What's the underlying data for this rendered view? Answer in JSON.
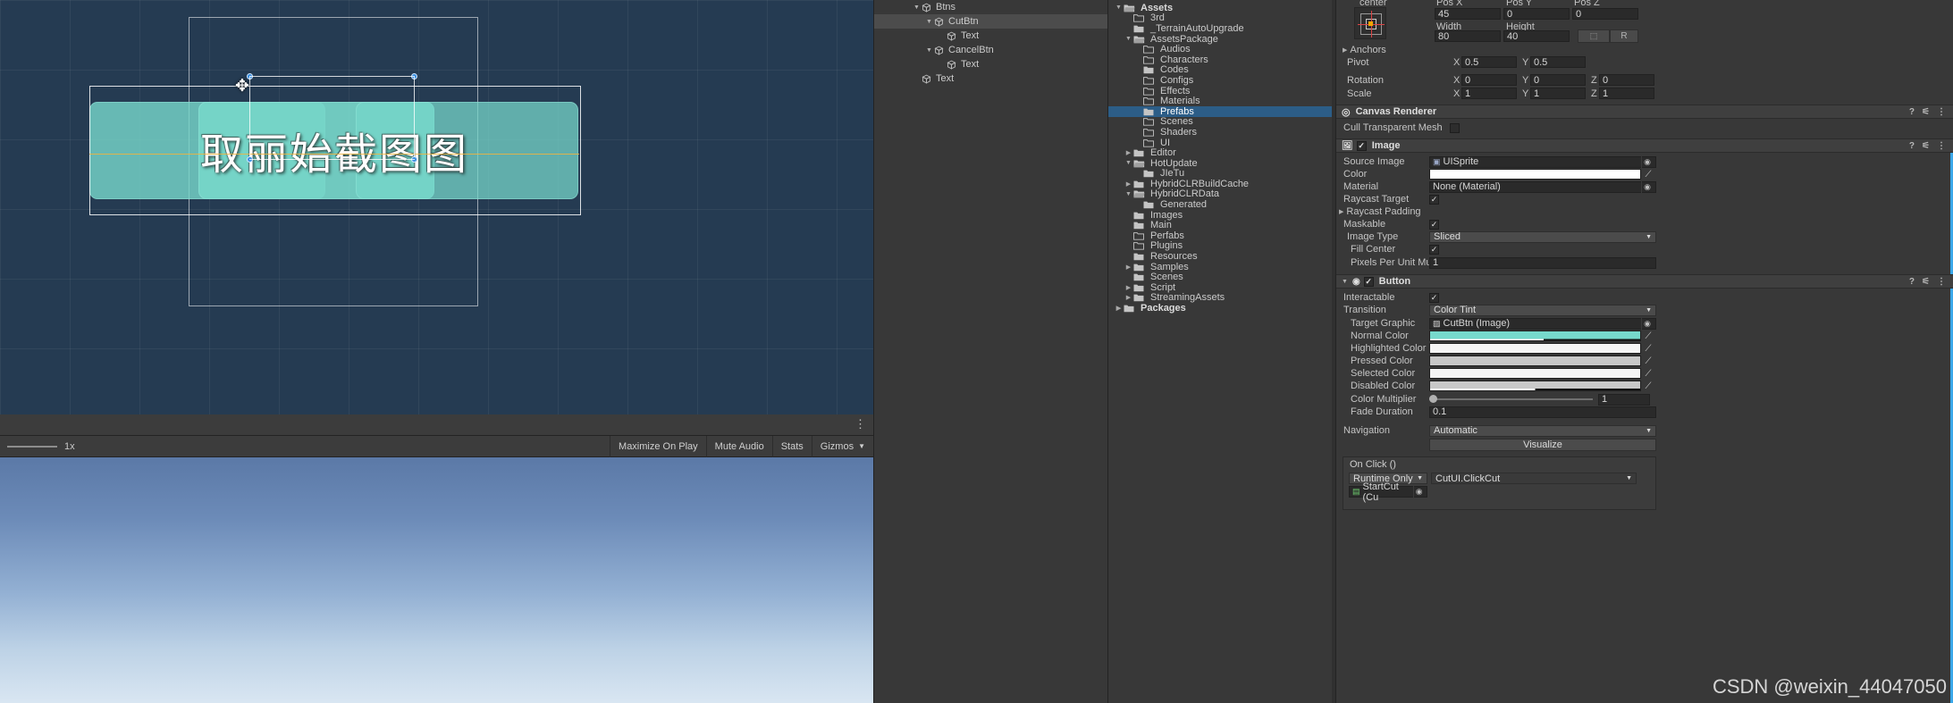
{
  "scene": {
    "overlapped_button_text": "取丽始截图图",
    "cursor_icon": "move-cursor-icon"
  },
  "gameview": {
    "zoom_label": "1x",
    "buttons": [
      {
        "label": "Maximize On Play",
        "name": "maximize-on-play"
      },
      {
        "label": "Mute Audio",
        "name": "mute-audio"
      },
      {
        "label": "Stats",
        "name": "stats"
      },
      {
        "label": "Gizmos",
        "name": "gizmos",
        "caret": "▼"
      }
    ],
    "kebab": "⋮"
  },
  "hierarchy": {
    "items": [
      {
        "label": "Btns",
        "indent": 3,
        "tri": "▼",
        "selected": false
      },
      {
        "label": "CutBtn",
        "indent": 4,
        "tri": "▼",
        "selected": true
      },
      {
        "label": "Text",
        "indent": 5,
        "tri": "",
        "selected": false
      },
      {
        "label": "CancelBtn",
        "indent": 4,
        "tri": "▼",
        "selected": false
      },
      {
        "label": "Text",
        "indent": 5,
        "tri": "",
        "selected": false
      },
      {
        "label": "Text",
        "indent": 3,
        "tri": "",
        "selected": false
      }
    ]
  },
  "project": {
    "items": [
      {
        "label": "Assets",
        "indent": 0,
        "tri": "▼",
        "icon": "folder-open",
        "bold": true,
        "selected": false
      },
      {
        "label": "3rd",
        "indent": 1,
        "tri": "",
        "icon": "folder-empty",
        "bold": false,
        "selected": false
      },
      {
        "label": "_TerrainAutoUpgrade",
        "indent": 1,
        "tri": "",
        "icon": "folder-full",
        "bold": false,
        "selected": false
      },
      {
        "label": "AssetsPackage",
        "indent": 1,
        "tri": "▼",
        "icon": "folder-open",
        "bold": false,
        "selected": false
      },
      {
        "label": "Audios",
        "indent": 2,
        "tri": "",
        "icon": "folder-empty",
        "bold": false,
        "selected": false
      },
      {
        "label": "Characters",
        "indent": 2,
        "tri": "",
        "icon": "folder-empty",
        "bold": false,
        "selected": false
      },
      {
        "label": "Codes",
        "indent": 2,
        "tri": "",
        "icon": "folder-full",
        "bold": false,
        "selected": false
      },
      {
        "label": "Configs",
        "indent": 2,
        "tri": "",
        "icon": "folder-empty",
        "bold": false,
        "selected": false
      },
      {
        "label": "Effects",
        "indent": 2,
        "tri": "",
        "icon": "folder-empty",
        "bold": false,
        "selected": false
      },
      {
        "label": "Materials",
        "indent": 2,
        "tri": "",
        "icon": "folder-empty",
        "bold": false,
        "selected": false
      },
      {
        "label": "Prefabs",
        "indent": 2,
        "tri": "",
        "icon": "folder-full",
        "bold": false,
        "selected": true
      },
      {
        "label": "Scenes",
        "indent": 2,
        "tri": "",
        "icon": "folder-empty",
        "bold": false,
        "selected": false
      },
      {
        "label": "Shaders",
        "indent": 2,
        "tri": "",
        "icon": "folder-empty",
        "bold": false,
        "selected": false
      },
      {
        "label": "UI",
        "indent": 2,
        "tri": "",
        "icon": "folder-empty",
        "bold": false,
        "selected": false
      },
      {
        "label": "Editor",
        "indent": 1,
        "tri": "▶",
        "icon": "folder-full",
        "bold": false,
        "selected": false
      },
      {
        "label": "HotUpdate",
        "indent": 1,
        "tri": "▼",
        "icon": "folder-open",
        "bold": false,
        "selected": false
      },
      {
        "label": "JIeTu",
        "indent": 2,
        "tri": "",
        "icon": "folder-full",
        "bold": false,
        "selected": false
      },
      {
        "label": "HybridCLRBuildCache",
        "indent": 1,
        "tri": "▶",
        "icon": "folder-full",
        "bold": false,
        "selected": false
      },
      {
        "label": "HybridCLRData",
        "indent": 1,
        "tri": "▼",
        "icon": "folder-open",
        "bold": false,
        "selected": false
      },
      {
        "label": "Generated",
        "indent": 2,
        "tri": "",
        "icon": "folder-full",
        "bold": false,
        "selected": false
      },
      {
        "label": "Images",
        "indent": 1,
        "tri": "",
        "icon": "folder-full",
        "bold": false,
        "selected": false
      },
      {
        "label": "Main",
        "indent": 1,
        "tri": "",
        "icon": "folder-full",
        "bold": false,
        "selected": false
      },
      {
        "label": "Perfabs",
        "indent": 1,
        "tri": "",
        "icon": "folder-empty",
        "bold": false,
        "selected": false
      },
      {
        "label": "Plugins",
        "indent": 1,
        "tri": "",
        "icon": "folder-empty",
        "bold": false,
        "selected": false
      },
      {
        "label": "Resources",
        "indent": 1,
        "tri": "",
        "icon": "folder-full",
        "bold": false,
        "selected": false
      },
      {
        "label": "Samples",
        "indent": 1,
        "tri": "▶",
        "icon": "folder-full",
        "bold": false,
        "selected": false
      },
      {
        "label": "Scenes",
        "indent": 1,
        "tri": "",
        "icon": "folder-full",
        "bold": false,
        "selected": false
      },
      {
        "label": "Script",
        "indent": 1,
        "tri": "▶",
        "icon": "folder-full",
        "bold": false,
        "selected": false
      },
      {
        "label": "StreamingAssets",
        "indent": 1,
        "tri": "▶",
        "icon": "folder-full",
        "bold": false,
        "selected": false
      },
      {
        "label": "Packages",
        "indent": 0,
        "tri": "▶",
        "icon": "folder-full",
        "bold": true,
        "selected": false
      }
    ]
  },
  "inspector": {
    "rect_transform": {
      "anchor_preset_label": "center",
      "pos_x_label": "Pos X",
      "pos_x": "45",
      "pos_y_label": "Pos Y",
      "pos_y": "0",
      "pos_z_label": "Pos Z",
      "pos_z": "0",
      "width_label": "Width",
      "width": "80",
      "height_label": "Height",
      "height": "40",
      "blueprint_btn": "⬚",
      "raw_btn": "R",
      "anchors_label": "Anchors",
      "pivot_label": "Pivot",
      "pivot_x": "0.5",
      "pivot_y": "0.5",
      "rotation_label": "Rotation",
      "rot_x": "0",
      "rot_y": "0",
      "rot_z": "0",
      "scale_label": "Scale",
      "scale_x": "1",
      "scale_y": "1",
      "scale_z": "1",
      "axis_x": "X",
      "axis_y": "Y",
      "axis_z": "Z"
    },
    "canvas_renderer": {
      "title": "Canvas Renderer",
      "cull_label": "Cull Transparent Mesh",
      "cull_checked": false
    },
    "image": {
      "title": "Image",
      "enabled": true,
      "source_image_label": "Source Image",
      "source_image_value": "UISprite",
      "color_label": "Color",
      "color_value": "#FFFFFF",
      "material_label": "Material",
      "material_value": "None (Material)",
      "raycast_target_label": "Raycast Target",
      "raycast_target_checked": true,
      "raycast_padding_label": "Raycast Padding",
      "maskable_label": "Maskable",
      "maskable_checked": true,
      "image_type_label": "Image Type",
      "image_type_value": "Sliced",
      "fill_center_label": "Fill Center",
      "fill_center_checked": true,
      "ppu_label": "Pixels Per Unit Multip",
      "ppu_value": "1"
    },
    "button": {
      "title": "Button",
      "enabled": true,
      "interactable_label": "Interactable",
      "interactable_checked": true,
      "transition_label": "Transition",
      "transition_value": "Color Tint",
      "target_graphic_label": "Target Graphic",
      "target_graphic_value": "CutBtn (Image)",
      "normal_color_label": "Normal Color",
      "normal_color_value": "#77D9CC",
      "highlighted_color_label": "Highlighted Color",
      "highlighted_color_value": "#F5F5F5",
      "pressed_color_label": "Pressed Color",
      "pressed_color_value": "#C8C8C8",
      "selected_color_label": "Selected Color",
      "selected_color_value": "#F5F5F5",
      "disabled_color_label": "Disabled Color",
      "disabled_color_value": "#C8C8C8",
      "color_multiplier_label": "Color Multiplier",
      "color_multiplier_value": "1",
      "fade_duration_label": "Fade Duration",
      "fade_duration_value": "0.1",
      "navigation_label": "Navigation",
      "navigation_value": "Automatic",
      "visualize_label": "Visualize",
      "on_click_title": "On Click ()",
      "on_click_mode": "Runtime Only",
      "on_click_function": "CutUI.ClickCut",
      "on_click_object": "StartCut (Cu"
    },
    "watermark": "CSDN @weixin_44047050"
  }
}
